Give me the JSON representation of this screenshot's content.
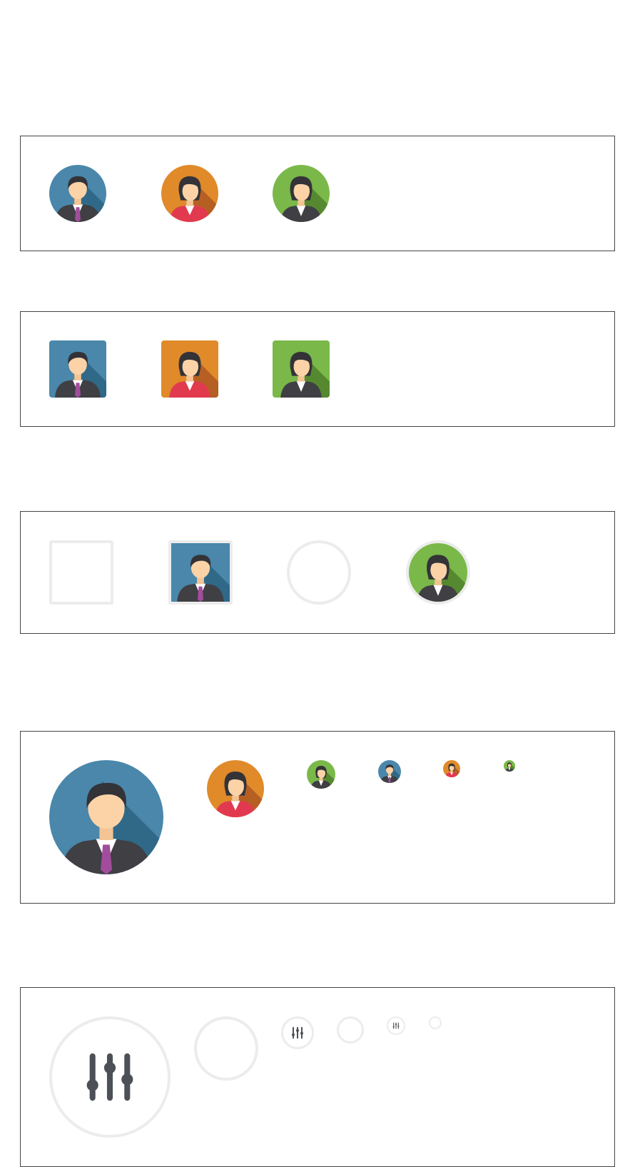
{
  "colors": {
    "blue": "#4a87ab",
    "orange": "#e08a2a",
    "green": "#7ab849",
    "frame": "#ececec",
    "border": "#444444",
    "icon": "#4d5157"
  },
  "icons": {
    "man": "man-avatar-icon",
    "woman_red": "woman-red-jacket-avatar-icon",
    "woman_dark": "woman-dark-jacket-avatar-icon",
    "settings": "sliders-icon"
  }
}
